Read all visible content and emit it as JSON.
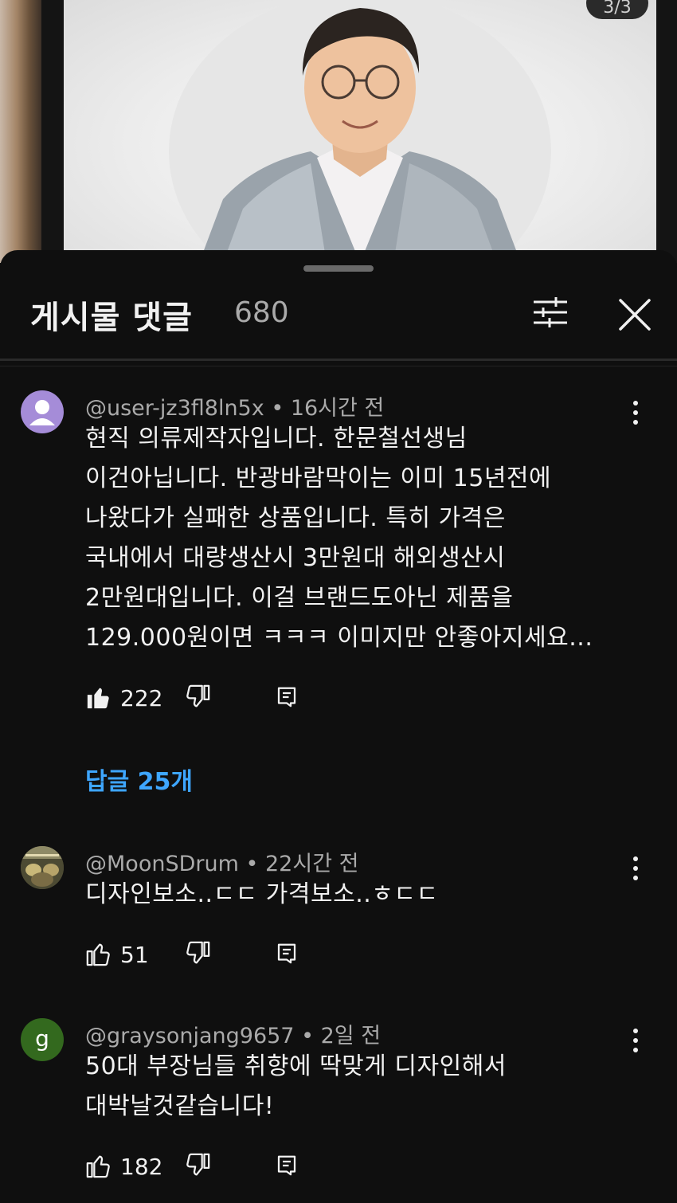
{
  "post": {
    "page_indicator": "3/3"
  },
  "comments_sheet": {
    "title": "게시물 댓글",
    "count": "680"
  },
  "comments": [
    {
      "author": "@user-jz3fl8ln5x",
      "time": "16시간 전",
      "text": "현직 의류제작자입니다. 한문철선생님\n이건아닙니다. 반광바람막이는 이미 15년전에\n나왔다가 실패한 상품입니다. 특히 가격은\n국내에서 대량생산시 3만원대 해외생산시\n2만원대입니다. 이걸 브랜드도아닌 제품을\n129.000원이면 ㅋㅋㅋ  이미지만 안좋아지세요...",
      "likes": "222",
      "liked": true,
      "replies_label": "답글 25개",
      "avatar_color": "#a58cd8"
    },
    {
      "author": "@MoonSDrum",
      "time": "22시간 전",
      "text": "디자인보소..ㄷㄷ 가격보소..ㅎㄷㄷ",
      "likes": "51",
      "liked": false
    },
    {
      "author": "@graysonjang9657",
      "time": "2일 전",
      "text": "50대 부장님들 취향에 딱맞게 디자인해서\n대박날것같습니다!",
      "likes": "182",
      "liked": false,
      "avatar_letter": "g",
      "avatar_color": "#33691e"
    }
  ],
  "colors": {
    "background": "#0f0f0f",
    "link": "#3ea6ff",
    "secondary_text": "#aaaaaa"
  }
}
